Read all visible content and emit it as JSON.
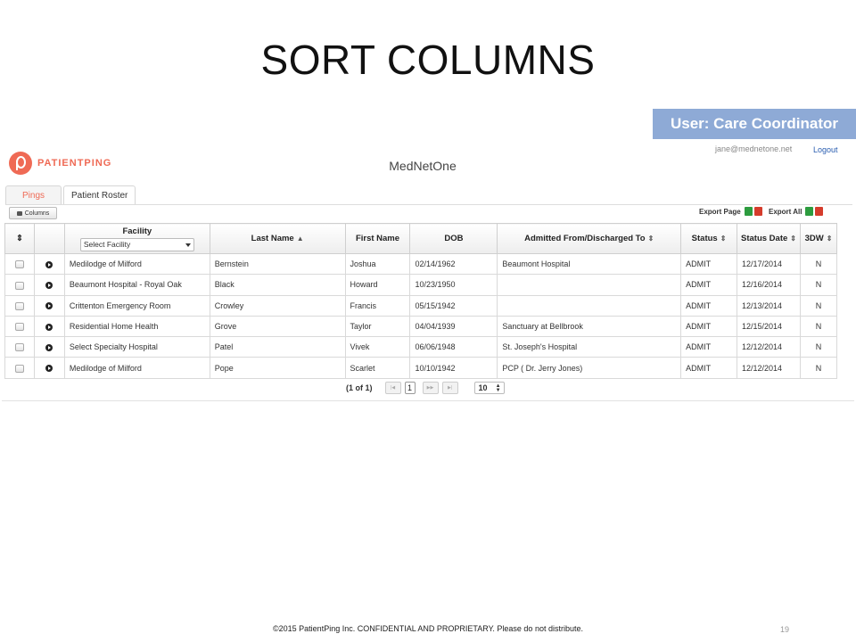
{
  "slide": {
    "title": "SORT COLUMNS",
    "footer": "©2015 PatientPing Inc. CONFIDENTIAL AND PROPRIETARY. Please do not distribute.",
    "page_number": "19",
    "badge": "User: Care Coordinator"
  },
  "header": {
    "logo_text": "PATIENTPING",
    "app_name": "MedNetOne",
    "user_email": "jane@mednetone.net",
    "logout_label": "Logout"
  },
  "tabs": [
    {
      "label": "Pings",
      "active": true
    },
    {
      "label": "Patient Roster",
      "active": false
    }
  ],
  "toolbar": {
    "columns_label": "Columns",
    "export_page_label": "Export Page",
    "export_all_label": "Export All"
  },
  "table": {
    "headers": {
      "sort_icon": "⇕",
      "facility": "Facility",
      "facility_placeholder": "Select Facility",
      "last_name": "Last Name",
      "last_name_sort": "▲",
      "first_name": "First Name",
      "dob": "DOB",
      "admitted": "Admitted From/Discharged To",
      "status": "Status",
      "status_date": "Status Date",
      "three_dw": "3DW"
    },
    "rows": [
      {
        "facility": "Medilodge of Milford",
        "last_name": "Bernstein",
        "first_name": "Joshua",
        "dob": "02/14/1962",
        "admitted": "Beaumont Hospital",
        "status": "ADMIT",
        "status_date": "12/17/2014",
        "three_dw": "N"
      },
      {
        "facility": "Beaumont Hospital - Royal Oak",
        "last_name": "Black",
        "first_name": "Howard",
        "dob": "10/23/1950",
        "admitted": "",
        "status": "ADMIT",
        "status_date": "12/16/2014",
        "three_dw": "N"
      },
      {
        "facility": "Crittenton Emergency Room",
        "last_name": "Crowley",
        "first_name": "Francis",
        "dob": "05/15/1942",
        "admitted": "",
        "status": "ADMIT",
        "status_date": "12/13/2014",
        "three_dw": "N"
      },
      {
        "facility": "Residential Home Health",
        "last_name": "Grove",
        "first_name": "Taylor",
        "dob": "04/04/1939",
        "admitted": "Sanctuary at Bellbrook",
        "status": "ADMIT",
        "status_date": "12/15/2014",
        "three_dw": "N"
      },
      {
        "facility": "Select Specialty Hospital",
        "last_name": "Patel",
        "first_name": "Vivek",
        "dob": "06/06/1948",
        "admitted": "St. Joseph's Hospital",
        "status": "ADMIT",
        "status_date": "12/12/2014",
        "three_dw": "N"
      },
      {
        "facility": "Medilodge of Milford",
        "last_name": "Pope",
        "first_name": "Scarlet",
        "dob": "10/10/1942",
        "admitted": "PCP ( Dr. Jerry Jones)",
        "status": "ADMIT",
        "status_date": "12/12/2014",
        "three_dw": "N"
      }
    ]
  },
  "pager": {
    "count": "(1 of 1)",
    "current_page": "1",
    "page_size": "10"
  },
  "colors": {
    "brand": "#ef6a55",
    "badge": "#8eaad6",
    "link": "#2a5db0"
  }
}
